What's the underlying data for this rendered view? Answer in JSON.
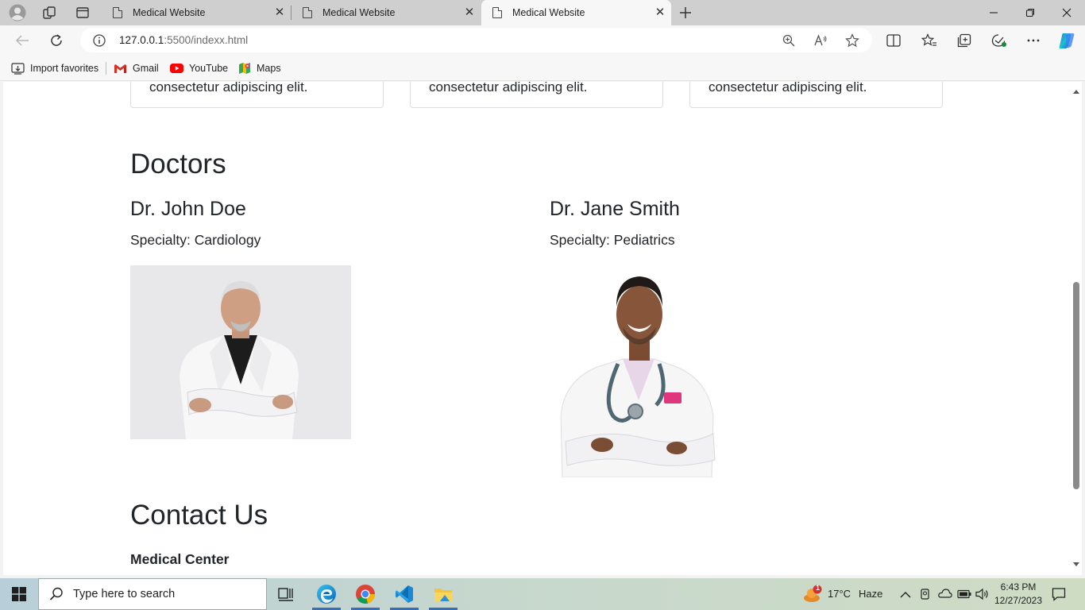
{
  "browser": {
    "tabs": [
      {
        "title": "Medical Website",
        "active": false
      },
      {
        "title": "Medical Website",
        "active": false
      },
      {
        "title": "Medical Website",
        "active": true
      }
    ],
    "url_host": "127.0.0.1",
    "url_path": ":5500/indexx.html",
    "favorites": [
      {
        "label": "Import favorites",
        "icon": "import-icon"
      },
      {
        "label": "Gmail",
        "icon": "gmail-icon"
      },
      {
        "label": "YouTube",
        "icon": "youtube-icon"
      },
      {
        "label": "Maps",
        "icon": "maps-icon"
      }
    ]
  },
  "page": {
    "service_cards": [
      {
        "text": "consectetur adipiscing elit."
      },
      {
        "text": "consectetur adipiscing elit."
      },
      {
        "text": "consectetur adipiscing elit."
      }
    ],
    "doctors_heading": "Doctors",
    "doctors": [
      {
        "name": "Dr. John Doe",
        "specialty": "Specialty: Cardiology"
      },
      {
        "name": "Dr. Jane Smith",
        "specialty": "Specialty: Pediatrics"
      }
    ],
    "contact_heading": "Contact Us",
    "contact_org": "Medical Center"
  },
  "taskbar": {
    "search_placeholder": "Type here to search",
    "weather_temp": "17°C",
    "weather_desc": "Haze",
    "weather_badge": "1",
    "time": "6:43 PM",
    "date": "12/27/2023"
  },
  "colors": {
    "tabstrip": "#cfcfcf",
    "toolbar": "#f7f7f7",
    "page_bg": "#ffffff",
    "text": "#212529",
    "taskbar_accent": "#3b6fb5"
  }
}
